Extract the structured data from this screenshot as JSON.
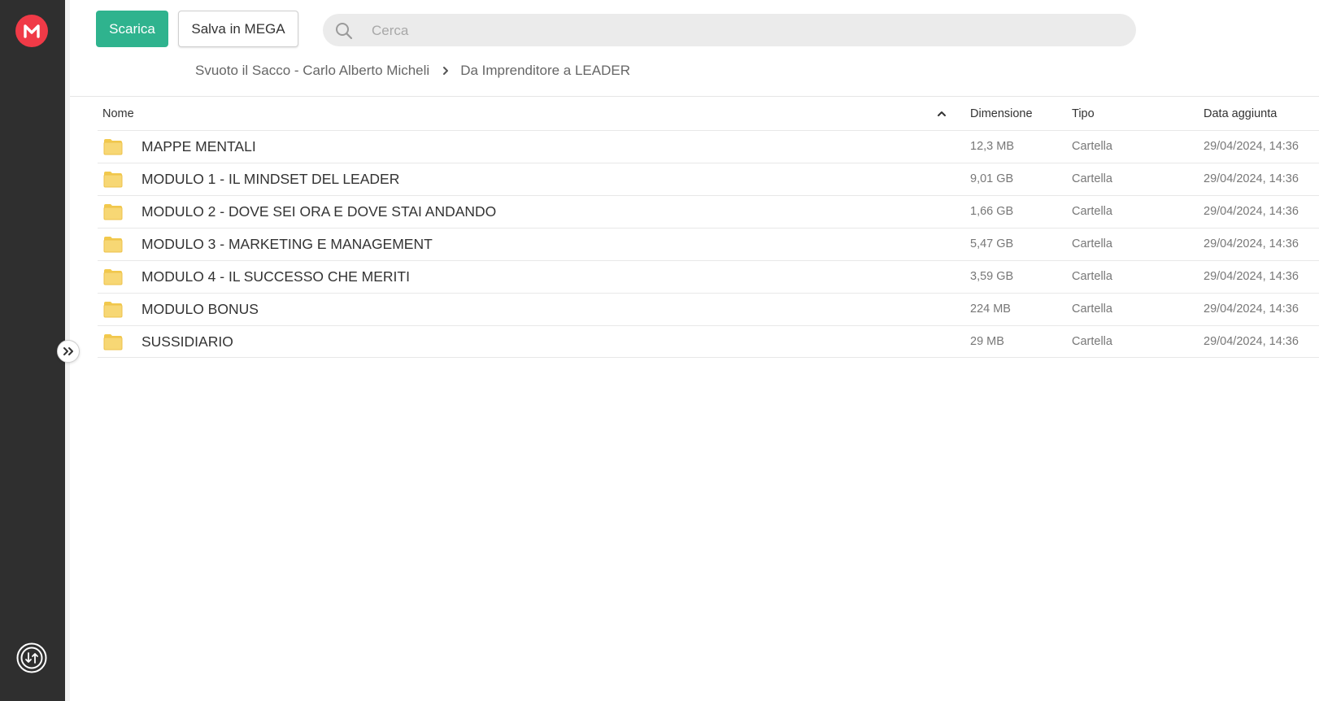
{
  "toolbar": {
    "download_label": "Scarica",
    "save_label": "Salva in MEGA"
  },
  "search": {
    "placeholder": "Cerca",
    "value": ""
  },
  "breadcrumb": [
    "Svuoto il Sacco - Carlo Alberto Micheli",
    "Da Imprenditore a LEADER"
  ],
  "table": {
    "columns": {
      "name": "Nome",
      "size": "Dimensione",
      "type": "Tipo",
      "date": "Data aggiunta"
    },
    "rows": [
      {
        "name": "MAPPE MENTALI",
        "size": "12,3 MB",
        "type": "Cartella",
        "date": "29/04/2024, 14:36"
      },
      {
        "name": "MODULO 1 - IL MINDSET DEL LEADER",
        "size": "9,01 GB",
        "type": "Cartella",
        "date": "29/04/2024, 14:36"
      },
      {
        "name": "MODULO 2 - DOVE SEI ORA E DOVE STAI ANDANDO",
        "size": "1,66 GB",
        "type": "Cartella",
        "date": "29/04/2024, 14:36"
      },
      {
        "name": "MODULO 3 - MARKETING E MANAGEMENT",
        "size": "5,47 GB",
        "type": "Cartella",
        "date": "29/04/2024, 14:36"
      },
      {
        "name": "MODULO 4 - IL SUCCESSO CHE MERITI",
        "size": "3,59 GB",
        "type": "Cartella",
        "date": "29/04/2024, 14:36"
      },
      {
        "name": "MODULO BONUS",
        "size": "224 MB",
        "type": "Cartella",
        "date": "29/04/2024, 14:36"
      },
      {
        "name": "SUSSIDIARIO",
        "size": "29 MB",
        "type": "Cartella",
        "date": "29/04/2024, 14:36"
      }
    ]
  },
  "icons": {
    "logo": "mega-logo-icon",
    "transfer": "transfer-manager-icon",
    "expand": "double-chevron-right-icon",
    "search": "search-icon",
    "sort": "chevron-up-icon",
    "folder": "folder-icon"
  },
  "colors": {
    "sidebar": "#2f2f2f",
    "brand_red": "#f03a47",
    "download_green": "#2fb38e",
    "folder_yellow": "#f7d774"
  }
}
